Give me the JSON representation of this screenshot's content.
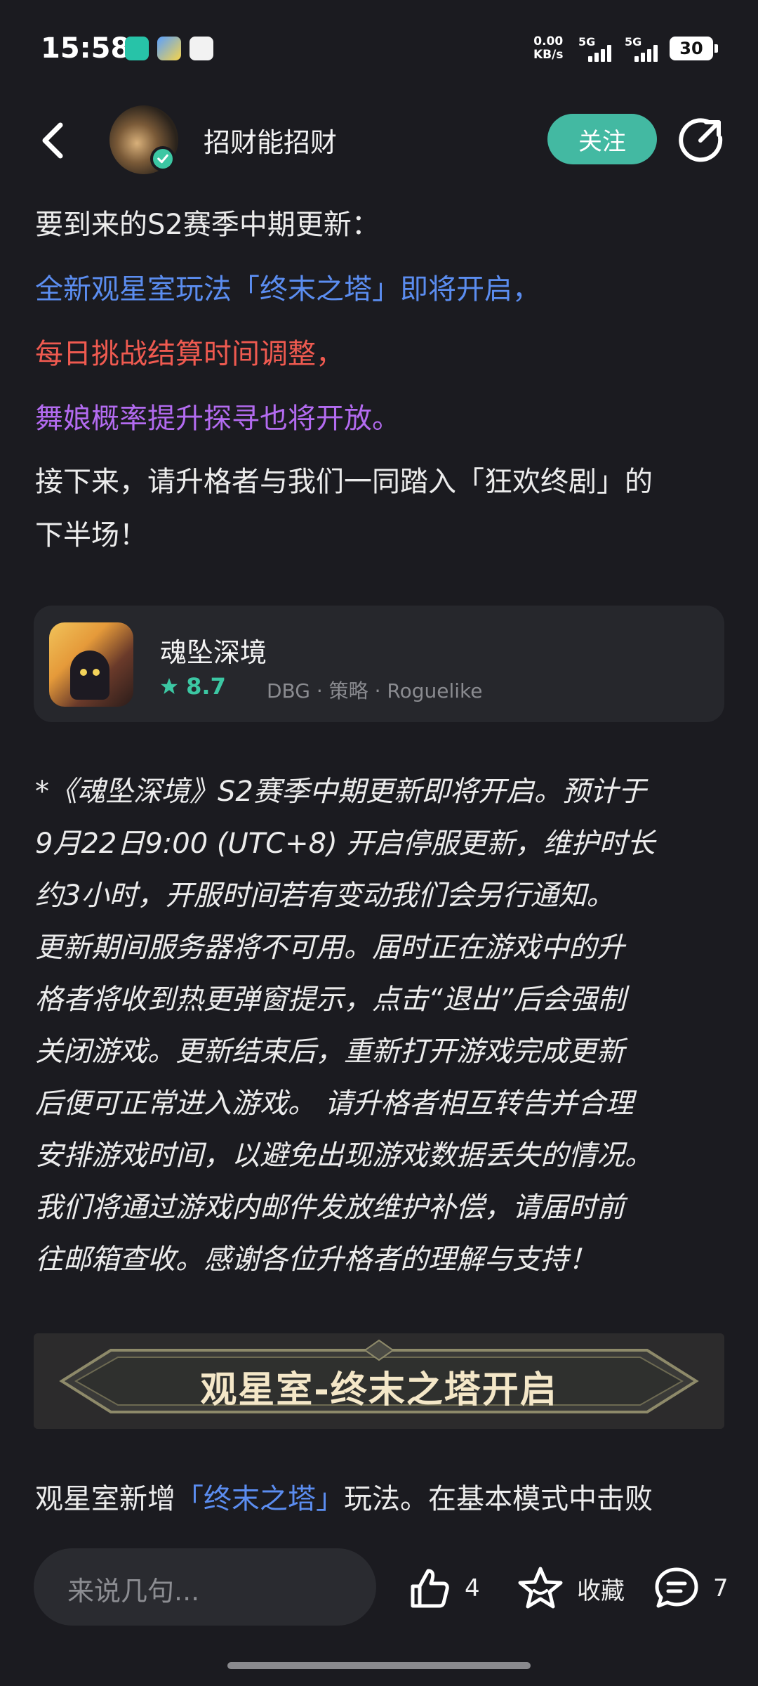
{
  "status": {
    "time": "15:58",
    "net_speed_value": "0.00",
    "net_speed_unit": "KB/s",
    "sim1": "5G",
    "sim2": "5G",
    "battery": "30"
  },
  "header": {
    "username": "招财能招财",
    "follow_label": "关注"
  },
  "article": {
    "intro": "要到来的S2赛季中期更新：",
    "line_blue": "全新观星室玩法「终末之塔」即将开启，",
    "line_red": "每日挑战结算时间调整，",
    "line_purple": "舞娘概率提升探寻也将开放。",
    "outro_1": "接下来，请升格者与我们一同踏入「狂欢终剧」的",
    "outro_2": "下半场！",
    "notice_lines": [
      "*《魂坠深境》S2赛季中期更新即将开启。预计于",
      "9月22日9:00 (UTC+8) 开启停服更新，维护时长",
      "约3小时，开服时间若有变动我们会另行通知。",
      "更新期间服务器将不可用。届时正在游戏中的升",
      "格者将收到热更弹窗提示，点击“退出”后会强制",
      "关闭游戏。更新结束后，重新打开游戏完成更新",
      "后便可正常进入游戏。 请升格者相互转告并合理",
      "安排游戏时间，以避免出现游戏数据丢失的情况。",
      "我们将通过游戏内邮件发放维护补偿，请届时前",
      "往邮箱查收。感谢各位升格者的理解与支持！"
    ],
    "banner_text": "观星室-终末之塔开启",
    "last_prefix": "观星室新增",
    "last_highlight": "「终末之塔」",
    "last_suffix": "玩法。在基本模式中击败"
  },
  "game_card": {
    "name": "魂坠深境",
    "rating": "8.7",
    "tags": "DBG · 策略 · Roguelike"
  },
  "bottom": {
    "comment_placeholder": "来说几句...",
    "like_count": "4",
    "favorite_label": "收藏",
    "comment_count": "7"
  },
  "colors": {
    "accent_teal": "#43b9a2",
    "blue": "#5b8df0",
    "red": "#ef5a50",
    "purple": "#b36bf0"
  },
  "icons": [
    "back-icon",
    "verified-icon",
    "share-icon",
    "star-icon",
    "like-icon",
    "favorite-icon",
    "comment-icon"
  ]
}
